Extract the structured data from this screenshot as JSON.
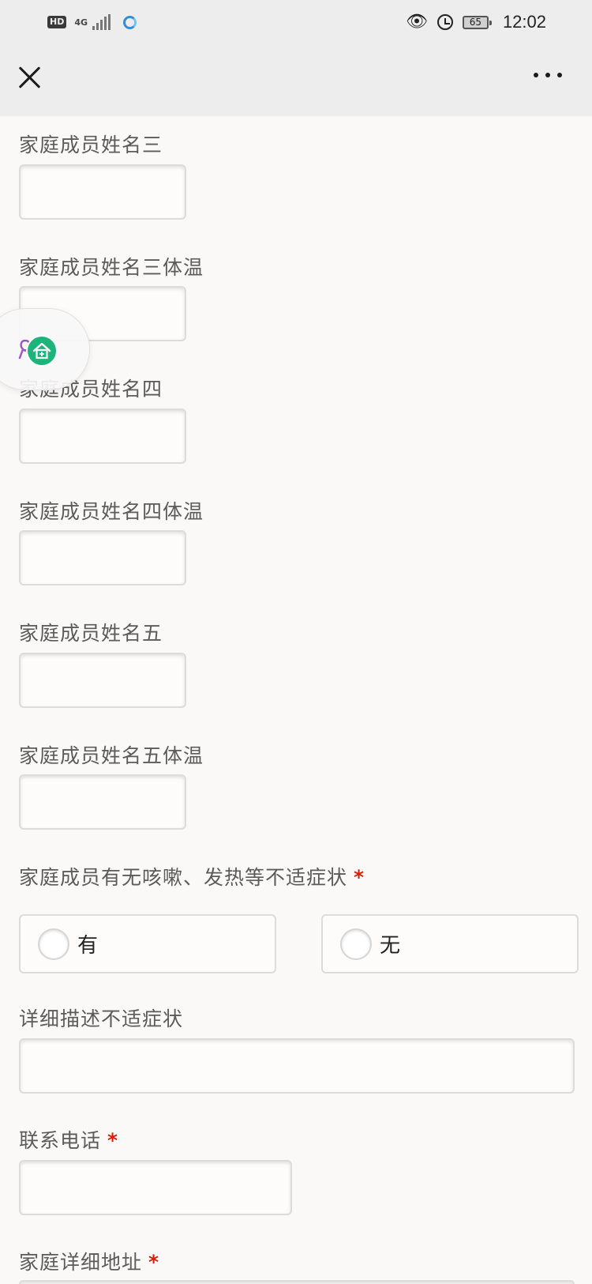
{
  "status_bar": {
    "hd": "HD",
    "network": "4G",
    "battery": "65",
    "time": "12:02"
  },
  "nav": {
    "close_icon": "close-icon",
    "more_icon": "more-horizontal-icon"
  },
  "form": {
    "member3_name_label": "家庭成员姓名三",
    "member3_temp_label": "家庭成员姓名三体温",
    "member4_name_label": "家庭成员姓名四",
    "member4_temp_label": "家庭成员姓名四体温",
    "member5_name_label": "家庭成员姓名五",
    "member5_temp_label": "家庭成员姓名五体温",
    "symptoms_question": "家庭成员有无咳嗽、发热等不适症状",
    "symptoms_options": [
      "有",
      "无"
    ],
    "symptoms_detail_label": "详细描述不适症状",
    "phone_label": "联系电话",
    "address_label": "家庭详细地址",
    "required_mark": "*"
  },
  "floating_widget": {
    "icons": [
      "ribbon-icon",
      "home-icon"
    ]
  }
}
